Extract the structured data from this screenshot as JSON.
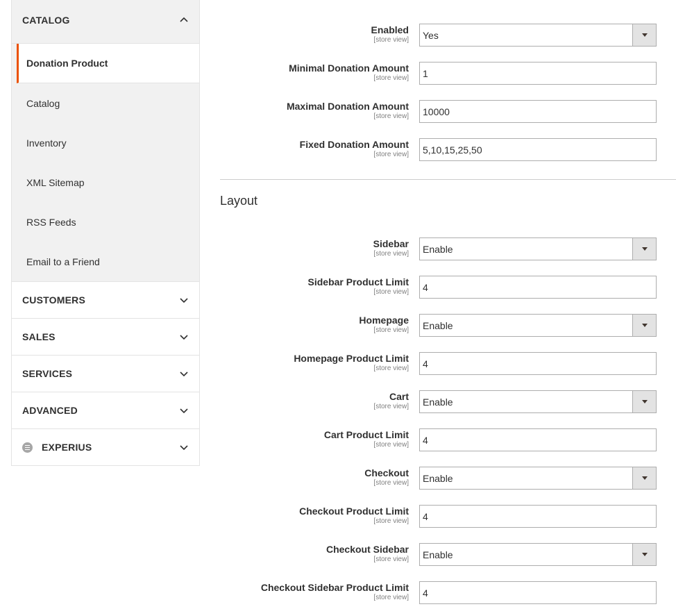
{
  "sidebar": {
    "catalog_label": "CATALOG",
    "catalog_items": [
      {
        "label": "Donation Product"
      },
      {
        "label": "Catalog"
      },
      {
        "label": "Inventory"
      },
      {
        "label": "XML Sitemap"
      },
      {
        "label": "RSS Feeds"
      },
      {
        "label": "Email to a Friend"
      }
    ],
    "sections": [
      {
        "label": "CUSTOMERS"
      },
      {
        "label": "SALES"
      },
      {
        "label": "SERVICES"
      },
      {
        "label": "ADVANCED"
      },
      {
        "label": "EXPERIUS"
      }
    ]
  },
  "scope_label": "[store view]",
  "general": [
    {
      "label": "Enabled",
      "value": "Yes",
      "type": "select"
    },
    {
      "label": "Minimal Donation Amount",
      "value": "1",
      "type": "input"
    },
    {
      "label": "Maximal Donation Amount",
      "value": "10000",
      "type": "input"
    },
    {
      "label": "Fixed Donation Amount",
      "value": "5,10,15,25,50",
      "type": "input"
    }
  ],
  "layout_title": "Layout",
  "layout": [
    {
      "label": "Sidebar",
      "value": "Enable",
      "type": "select"
    },
    {
      "label": "Sidebar Product Limit",
      "value": "4",
      "type": "input"
    },
    {
      "label": "Homepage",
      "value": "Enable",
      "type": "select"
    },
    {
      "label": "Homepage Product Limit",
      "value": "4",
      "type": "input"
    },
    {
      "label": "Cart",
      "value": "Enable",
      "type": "select"
    },
    {
      "label": "Cart Product Limit",
      "value": "4",
      "type": "input"
    },
    {
      "label": "Checkout",
      "value": "Enable",
      "type": "select"
    },
    {
      "label": "Checkout Product Limit",
      "value": "4",
      "type": "input"
    },
    {
      "label": "Checkout Sidebar",
      "value": "Enable",
      "type": "select"
    },
    {
      "label": "Checkout Sidebar Product Limit",
      "value": "4",
      "type": "input"
    }
  ],
  "colors": {
    "accent": "#eb5202",
    "sidebar_bg": "#f1f1f1",
    "border": "#adadad"
  }
}
